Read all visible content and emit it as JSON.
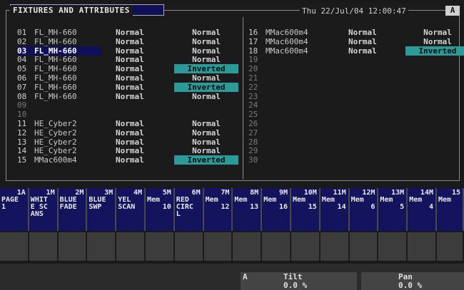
{
  "header": {
    "title": "FIXTURES AND ATTRIBUTES",
    "datetime": "Thu 22/Jul/04  12:00:47",
    "badge": "A"
  },
  "left_rows": [
    {
      "num": "01",
      "name": "FL_MH-660",
      "c1": "Normal",
      "c2": "Normal"
    },
    {
      "num": "02",
      "name": "FL_MH-660",
      "c1": "Normal",
      "c2": "Normal"
    },
    {
      "num": "03",
      "name": "FL_MH-660",
      "c1": "Normal",
      "c2": "Normal"
    },
    {
      "num": "04",
      "name": "FL_MH-660",
      "c1": "Normal",
      "c2": "Normal"
    },
    {
      "num": "05",
      "name": "FL_MH-660",
      "c1": "Normal",
      "c2": "Inverted"
    },
    {
      "num": "06",
      "name": "FL_MH-660",
      "c1": "Normal",
      "c2": "Normal"
    },
    {
      "num": "07",
      "name": "FL_MH-660",
      "c1": "Normal",
      "c2": "Inverted"
    },
    {
      "num": "08",
      "name": "FL_MH-660",
      "c1": "Normal",
      "c2": "Normal"
    },
    {
      "num": "09",
      "name": "",
      "c1": "",
      "c2": ""
    },
    {
      "num": "10",
      "name": "",
      "c1": "",
      "c2": ""
    },
    {
      "num": "11",
      "name": "HE_Cyber2",
      "c1": "Normal",
      "c2": "Normal"
    },
    {
      "num": "12",
      "name": "HE_Cyber2",
      "c1": "Normal",
      "c2": "Normal"
    },
    {
      "num": "13",
      "name": "HE_Cyber2",
      "c1": "Normal",
      "c2": "Normal"
    },
    {
      "num": "14",
      "name": "HE_Cyber2",
      "c1": "Normal",
      "c2": "Normal"
    },
    {
      "num": "15",
      "name": "MMac600m4",
      "c1": "Normal",
      "c2": "Inverted"
    }
  ],
  "right_rows": [
    {
      "num": "16",
      "name": "MMac600m4",
      "c1": "Normal",
      "c2": "Normal"
    },
    {
      "num": "17",
      "name": "MMac600m4",
      "c1": "Normal",
      "c2": "Normal"
    },
    {
      "num": "18",
      "name": "MMac600m4",
      "c1": "Normal",
      "c2": "Inverted"
    },
    {
      "num": "19",
      "name": "",
      "c1": "",
      "c2": ""
    },
    {
      "num": "20",
      "name": "",
      "c1": "",
      "c2": ""
    },
    {
      "num": "21",
      "name": "",
      "c1": "",
      "c2": ""
    },
    {
      "num": "22",
      "name": "",
      "c1": "",
      "c2": ""
    },
    {
      "num": "23",
      "name": "",
      "c1": "",
      "c2": ""
    },
    {
      "num": "24",
      "name": "",
      "c1": "",
      "c2": ""
    },
    {
      "num": "25",
      "name": "",
      "c1": "",
      "c2": ""
    },
    {
      "num": "26",
      "name": "",
      "c1": "",
      "c2": ""
    },
    {
      "num": "27",
      "name": "",
      "c1": "",
      "c2": ""
    },
    {
      "num": "28",
      "name": "",
      "c1": "",
      "c2": ""
    },
    {
      "num": "29",
      "name": "",
      "c1": "",
      "c2": ""
    },
    {
      "num": "30",
      "name": "",
      "c1": "",
      "c2": ""
    }
  ],
  "selected_row": "03",
  "memory_keys": [
    {
      "hdr": "1A",
      "lines": [
        "PAGE",
        "1"
      ]
    },
    {
      "hdr": "1M",
      "lines": [
        "WHIT",
        "E SC",
        "ANS"
      ]
    },
    {
      "hdr": "2M",
      "lines": [
        "BLUE",
        "FADE"
      ]
    },
    {
      "hdr": "3M",
      "lines": [
        "BLUE",
        "SWP"
      ]
    },
    {
      "hdr": "4M",
      "lines": [
        "YEL",
        "SCAN"
      ]
    },
    {
      "hdr": "5M",
      "lines": [
        "Mem",
        "10"
      ]
    },
    {
      "hdr": "6M",
      "lines": [
        "RED",
        "CIRC",
        "L"
      ]
    },
    {
      "hdr": "7M",
      "lines": [
        "Mem",
        "12"
      ]
    },
    {
      "hdr": "8M",
      "lines": [
        "Mem",
        "13"
      ]
    },
    {
      "hdr": "9M",
      "lines": [
        "Mem",
        "16"
      ]
    },
    {
      "hdr": "10M",
      "lines": [
        "Mem",
        "15"
      ]
    },
    {
      "hdr": "11M",
      "lines": [
        "Mem",
        "14"
      ]
    },
    {
      "hdr": "12M",
      "lines": [
        "Mem",
        "6"
      ]
    },
    {
      "hdr": "13M",
      "lines": [
        "Mem",
        "5"
      ]
    },
    {
      "hdr": "14M",
      "lines": [
        "Mem",
        "4"
      ]
    },
    {
      "hdr": "15",
      "lines": [
        "Mem",
        ""
      ]
    }
  ],
  "encoders": {
    "letter": "A",
    "tilt_label": "Tilt",
    "tilt_value": "0.0 %",
    "pan_label": "Pan",
    "pan_value": "0.0 %"
  },
  "colors": {
    "inverted_bg": "#2d9a9a",
    "memory_key_bg": "#14145e",
    "selected_bg": "#101058"
  }
}
